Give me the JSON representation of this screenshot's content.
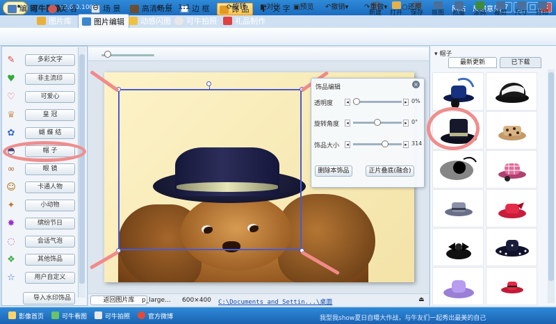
{
  "app": {
    "name": "可牛影像",
    "version": "v2.6.0.1001",
    "site_link": "网站",
    "feedback_link": "反馈意见"
  },
  "title_tabs": [
    {
      "label": "图片库",
      "icon": "gallery-icon"
    },
    {
      "label": "图片编辑",
      "icon": "edit-image-icon"
    },
    {
      "label": "动感闪图",
      "icon": "flash-image-icon"
    },
    {
      "label": "可牛拍照",
      "icon": "camera-icon"
    },
    {
      "label": "礼品制作",
      "icon": "gift-icon"
    }
  ],
  "window_buttons": [
    "?",
    "_",
    "□",
    "×"
  ],
  "toolbar": {
    "left": [
      {
        "label": "编 辑",
        "icon": "edit-icon"
      },
      {
        "label": "美 容",
        "icon": "beauty-icon"
      },
      {
        "label": "场 景",
        "icon": "scene-icon"
      },
      {
        "label": "高清场景",
        "icon": "hd-scene-icon"
      },
      {
        "label": "边 框",
        "icon": "frame-icon"
      },
      {
        "label": "饰 品",
        "icon": "ornament-icon"
      },
      {
        "label": "文 字",
        "icon": "text-icon"
      }
    ],
    "right": [
      "新建",
      "打开",
      "保存",
      "抠图",
      "批量",
      "涂鸦",
      "裁剪",
      "尺寸",
      "打印"
    ]
  },
  "categories": [
    {
      "label": "多彩文字",
      "icon": "✎"
    },
    {
      "label": "非主流印",
      "icon": "♥"
    },
    {
      "label": "可爱心",
      "icon": "♡"
    },
    {
      "label": "皇 冠",
      "icon": "♛"
    },
    {
      "label": "蝴 蝶 结",
      "icon": "✿"
    },
    {
      "label": "帽 子",
      "icon": "◓"
    },
    {
      "label": "眼 镜",
      "icon": "∞"
    },
    {
      "label": "卡通人物",
      "icon": "☺"
    },
    {
      "label": "小动物",
      "icon": "✦"
    },
    {
      "label": "缤纷节日",
      "icon": "✸"
    },
    {
      "label": "会话气泡",
      "icon": "◌"
    },
    {
      "label": "其他饰品",
      "icon": "❖"
    },
    {
      "label": "用户自定义",
      "icon": "☆"
    }
  ],
  "import_watermark_label": "导入水印饰品",
  "canvas_controls": {
    "zoom_ratio": "1:1",
    "zoom_level": 0.05,
    "rotate": "旋转",
    "compare": "对比",
    "preview": "预览",
    "undo": "撤销",
    "redo": "重做",
    "restore": "还原"
  },
  "ornament_editor": {
    "title": "饰品编辑",
    "opacity": {
      "label": "透明度",
      "value": "0%",
      "level": 0.0
    },
    "rotation": {
      "label": "旋转角度",
      "value": "0°",
      "level": 0.5
    },
    "size": {
      "label": "饰品大小",
      "value": "314",
      "level": 0.68
    },
    "delete_label": "删除本饰品",
    "blend_label": "正片叠底(融合)"
  },
  "canvas_status": {
    "back_label": "返回图片库",
    "file_name": "p_large...",
    "dimensions": "600×400",
    "path": "C:\\Documents and Settin...\\桌面"
  },
  "right_panel": {
    "section_title": "帽子",
    "tab_latest": "最新更新",
    "tab_downloaded": "已下载",
    "hats": [
      {
        "name": "blue-feather-hat-icon"
      },
      {
        "name": "black-white-cap-icon"
      },
      {
        "name": "black-top-hat-icon"
      },
      {
        "name": "leopard-hat-icon"
      },
      {
        "name": "veil-fascinator-icon"
      },
      {
        "name": "pink-plaid-hat-icon"
      },
      {
        "name": "grey-fedora-icon"
      },
      {
        "name": "red-bow-hat-icon"
      },
      {
        "name": "black-bow-hat-icon"
      },
      {
        "name": "polka-dot-hat-icon"
      },
      {
        "name": "lilac-hat-icon"
      },
      {
        "name": "red-mini-hat-icon"
      }
    ]
  },
  "bottom_bar": {
    "items": [
      "影像首页",
      "可牛看图",
      "可牛拍照",
      "官方微博"
    ],
    "marquee": "我型我show夏日自曝大作战，与牛友们一起秀出最美的自己"
  },
  "colors": {
    "accent": "#1a6cc0",
    "active_tool": "#ffc24a",
    "annotation": "#f28a8a",
    "selection": "#4a5ad0"
  }
}
